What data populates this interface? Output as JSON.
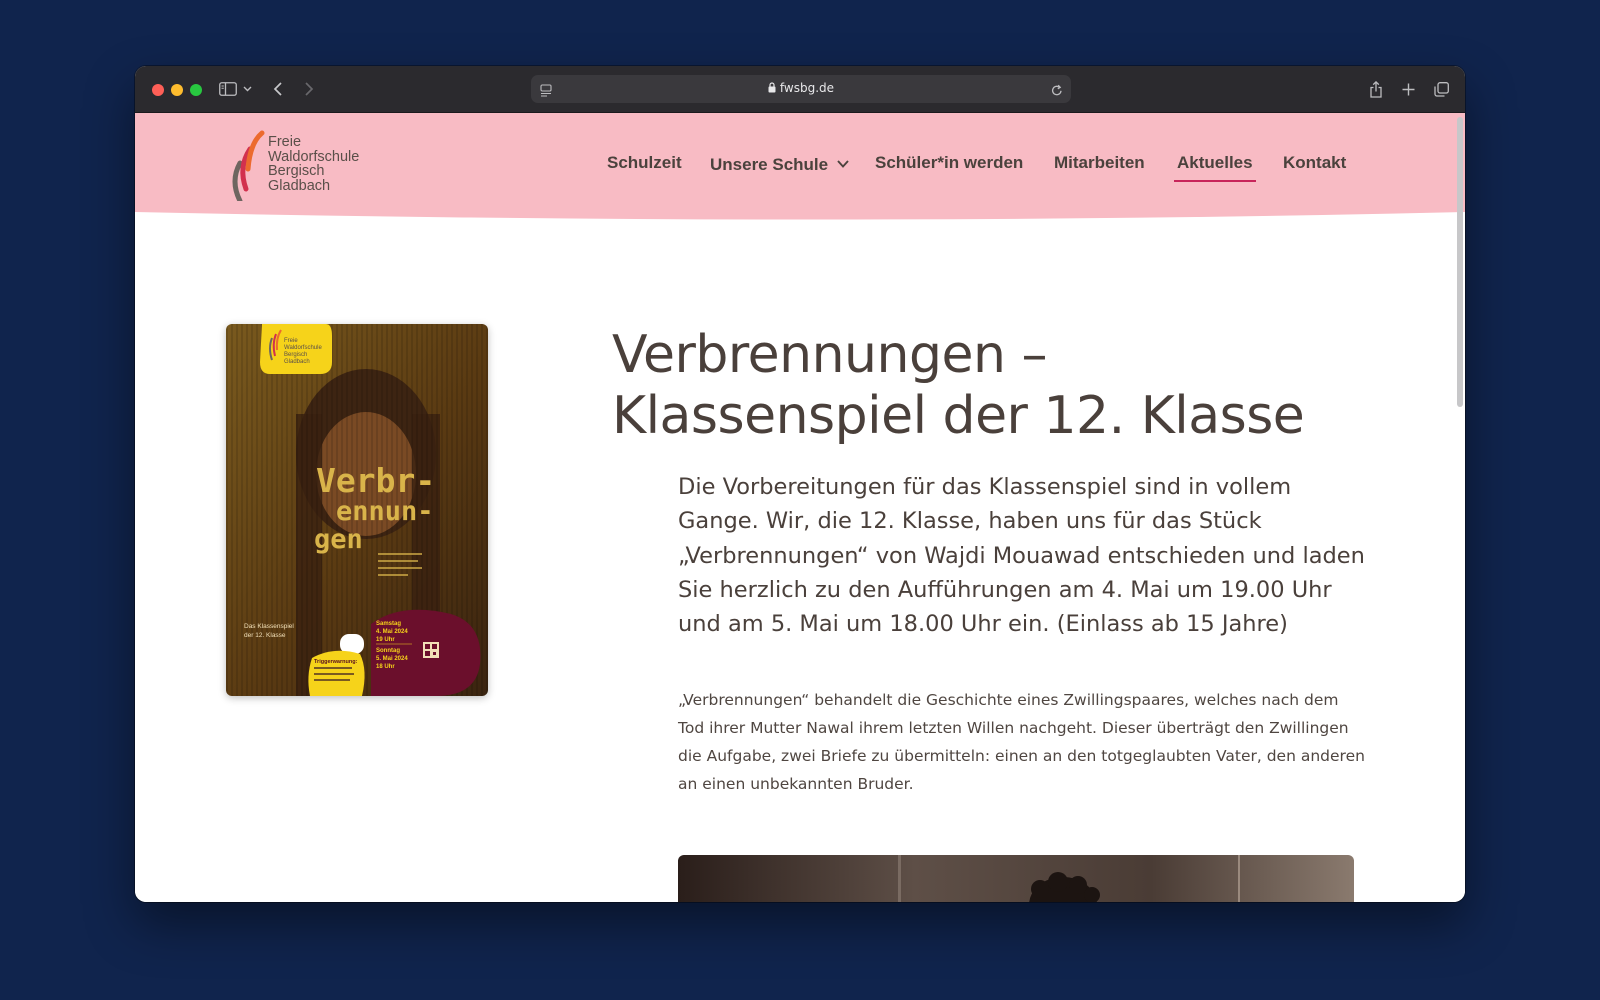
{
  "browser": {
    "url": "fwsbg.de"
  },
  "site": {
    "logo_lines": [
      "Freie",
      "Waldorfschule",
      "Bergisch",
      "Gladbach"
    ],
    "nav": [
      {
        "label": "Schulzeit"
      },
      {
        "label": "Unsere Schule",
        "has_dropdown": true
      },
      {
        "label": "Schüler*in werden"
      },
      {
        "label": "Mitarbeiten"
      },
      {
        "label": "Aktuelles",
        "active": true
      },
      {
        "label": "Kontakt"
      }
    ],
    "colors": {
      "header": "#f8bbc4",
      "accent": "#c8245a",
      "text": "#4a403b"
    }
  },
  "poster": {
    "logo_lines": [
      "Freie",
      "Waldorfschule",
      "Bergisch",
      "Gladbach"
    ],
    "title_lines": [
      "Verbr-",
      "ennun-",
      "gen"
    ],
    "subtitle_lines": [
      "Das Klassenspiel",
      "der 12. Klasse"
    ],
    "dates": [
      "Samstag",
      "4. Mai 2024",
      "19 Uhr",
      "Sonntag",
      "5. Mai 2024",
      "18 Uhr"
    ],
    "warning_title": "Triggerwarnung:"
  },
  "article": {
    "title": "Verbrennungen – Klassenspiel der 12. Klasse",
    "lead": "Die Vorbereitungen für das Klassenspiel sind in vollem Gange. Wir, die 12. Klasse, haben uns für das Stück „Verbrennungen“ von Wajdi Mouawad entschieden und laden Sie herzlich zu den Aufführungen am 4. Mai um 19.00 Uhr und am 5. Mai um 18.00 Uhr ein. (Einlass ab 15 Jahre)",
    "body": "„Verbrennungen“ behandelt die Geschichte eines Zwillingspaares, welches nach dem Tod ihrer Mutter Nawal ihrem letzten Willen nachgeht. Dieser überträgt den Zwillingen die Aufgabe, zwei Briefe zu übermitteln: einen an den totgeglaubten Vater, den anderen an einen unbekannten Bruder."
  }
}
